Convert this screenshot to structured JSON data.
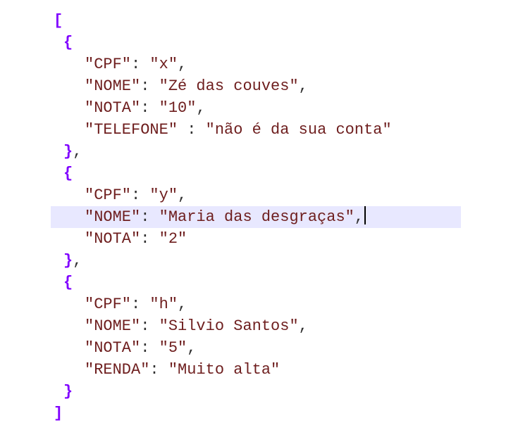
{
  "colors": {
    "bracket": "#8000ff",
    "key": "#6e1e1e",
    "string": "#6e1e1e",
    "punct": "#303030",
    "current_line": "#e8e8ff"
  },
  "lines": [
    {
      "indent": 0,
      "tokens": [
        {
          "t": "bracket",
          "v": "["
        }
      ]
    },
    {
      "indent": 1,
      "tokens": [
        {
          "t": "bracket",
          "v": "{"
        }
      ]
    },
    {
      "indent": 2,
      "tokens": [
        {
          "t": "key",
          "v": "\"CPF\""
        },
        {
          "t": "punct",
          "v": ": "
        },
        {
          "t": "string",
          "v": "\"x\""
        },
        {
          "t": "punct",
          "v": ","
        }
      ]
    },
    {
      "indent": 2,
      "tokens": [
        {
          "t": "key",
          "v": "\"NOME\""
        },
        {
          "t": "punct",
          "v": ": "
        },
        {
          "t": "string",
          "v": "\"Zé das couves\""
        },
        {
          "t": "punct",
          "v": ","
        }
      ]
    },
    {
      "indent": 2,
      "tokens": [
        {
          "t": "key",
          "v": "\"NOTA\""
        },
        {
          "t": "punct",
          "v": ": "
        },
        {
          "t": "string",
          "v": "\"10\""
        },
        {
          "t": "punct",
          "v": ","
        }
      ]
    },
    {
      "indent": 2,
      "tokens": [
        {
          "t": "key",
          "v": "\"TELEFONE\""
        },
        {
          "t": "punct",
          "v": " : "
        },
        {
          "t": "string",
          "v": "\"não é da sua conta\""
        }
      ]
    },
    {
      "indent": 1,
      "tokens": [
        {
          "t": "bracket",
          "v": "}"
        },
        {
          "t": "punct",
          "v": ","
        }
      ]
    },
    {
      "indent": 1,
      "tokens": [
        {
          "t": "bracket",
          "v": "{"
        }
      ]
    },
    {
      "indent": 2,
      "tokens": [
        {
          "t": "key",
          "v": "\"CPF\""
        },
        {
          "t": "punct",
          "v": ": "
        },
        {
          "t": "string",
          "v": "\"y\""
        },
        {
          "t": "punct",
          "v": ","
        }
      ]
    },
    {
      "indent": 2,
      "current": true,
      "caret": true,
      "tokens": [
        {
          "t": "key",
          "v": "\"NOME\""
        },
        {
          "t": "punct",
          "v": ": "
        },
        {
          "t": "string",
          "v": "\"Maria das desgraças\""
        },
        {
          "t": "punct",
          "v": ","
        }
      ]
    },
    {
      "indent": 2,
      "tokens": [
        {
          "t": "key",
          "v": "\"NOTA\""
        },
        {
          "t": "punct",
          "v": ": "
        },
        {
          "t": "string",
          "v": "\"2\""
        }
      ]
    },
    {
      "indent": 1,
      "tokens": [
        {
          "t": "bracket",
          "v": "}"
        },
        {
          "t": "punct",
          "v": ","
        }
      ]
    },
    {
      "indent": 1,
      "tokens": [
        {
          "t": "bracket",
          "v": "{"
        }
      ]
    },
    {
      "indent": 2,
      "tokens": [
        {
          "t": "key",
          "v": "\"CPF\""
        },
        {
          "t": "punct",
          "v": ": "
        },
        {
          "t": "string",
          "v": "\"h\""
        },
        {
          "t": "punct",
          "v": ","
        }
      ]
    },
    {
      "indent": 2,
      "tokens": [
        {
          "t": "key",
          "v": "\"NOME\""
        },
        {
          "t": "punct",
          "v": ": "
        },
        {
          "t": "string",
          "v": "\"Silvio Santos\""
        },
        {
          "t": "punct",
          "v": ","
        }
      ]
    },
    {
      "indent": 2,
      "tokens": [
        {
          "t": "key",
          "v": "\"NOTA\""
        },
        {
          "t": "punct",
          "v": ": "
        },
        {
          "t": "string",
          "v": "\"5\""
        },
        {
          "t": "punct",
          "v": ","
        }
      ]
    },
    {
      "indent": 2,
      "tokens": [
        {
          "t": "key",
          "v": "\"RENDA\""
        },
        {
          "t": "punct",
          "v": ": "
        },
        {
          "t": "string",
          "v": "\"Muito alta\""
        }
      ]
    },
    {
      "indent": 1,
      "tokens": [
        {
          "t": "bracket",
          "v": "}"
        }
      ]
    },
    {
      "indent": 0,
      "tokens": [
        {
          "t": "bracket",
          "v": "]"
        }
      ]
    }
  ]
}
